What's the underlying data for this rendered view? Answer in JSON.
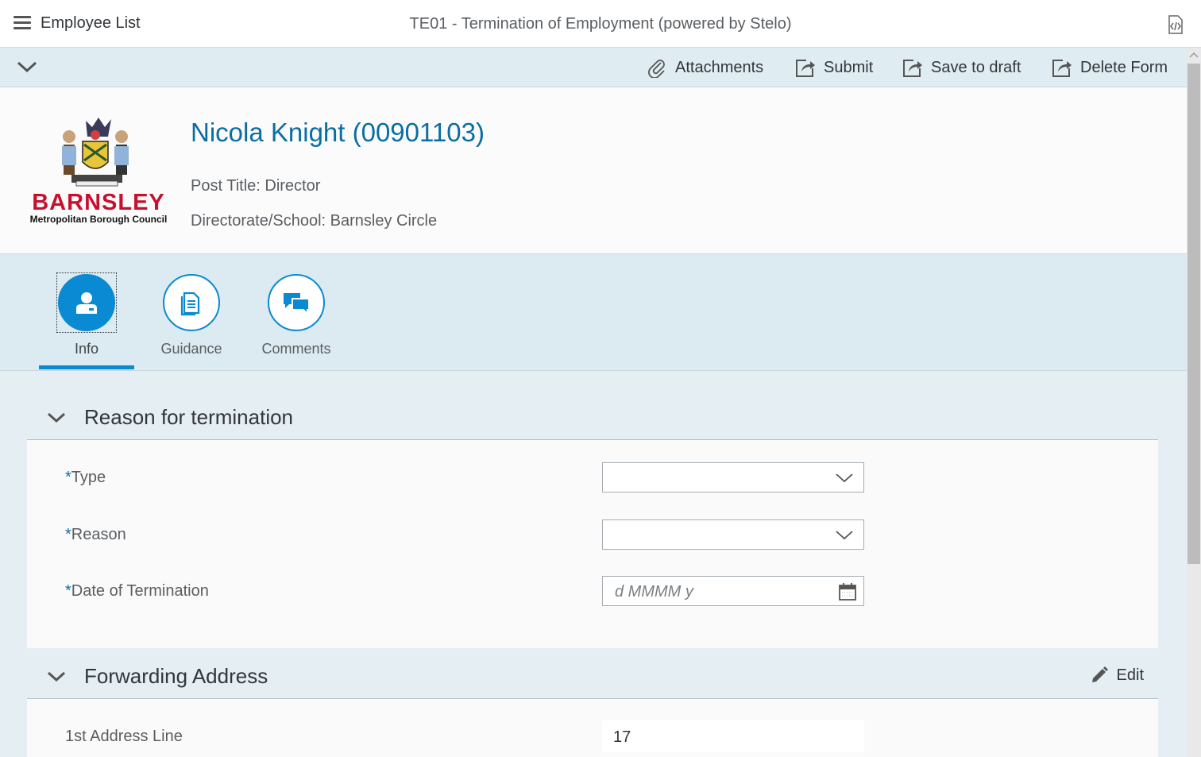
{
  "shell": {
    "back_title": "Employee List",
    "app_title": "TE01 - Termination of Employment (powered by Stelo)"
  },
  "toolbar": {
    "attachments": "Attachments",
    "submit": "Submit",
    "save_to_draft": "Save to draft",
    "delete_form": "Delete Form"
  },
  "header": {
    "logo_text": "BARNSLEY",
    "logo_subtext": "Metropolitan Borough Council",
    "employee_name": "Nicola Knight (00901103)",
    "post_title": "Post Title: Director",
    "directorate": "Directorate/School: Barnsley Circle"
  },
  "tabs": [
    {
      "label": "Info",
      "icon": "person-icon",
      "active": true
    },
    {
      "label": "Guidance",
      "icon": "document-icon",
      "active": false
    },
    {
      "label": "Comments",
      "icon": "comments-icon",
      "active": false
    }
  ],
  "sections": {
    "reason": {
      "title": "Reason for termination",
      "fields": {
        "type_label": "Type",
        "reason_label": "Reason",
        "date_label": "Date of Termination",
        "date_placeholder": "d MMMM y",
        "required_marker": "*"
      }
    },
    "forwarding": {
      "title": "Forwarding Address",
      "edit_label": "Edit",
      "address_line1_label": "1st Address Line",
      "address_line1_value": "17"
    }
  },
  "colors": {
    "accent": "#0a8ad2",
    "name_blue": "#0a6ea3",
    "toolbar_bg": "#dfecf1",
    "logo_red": "#c8102e"
  }
}
